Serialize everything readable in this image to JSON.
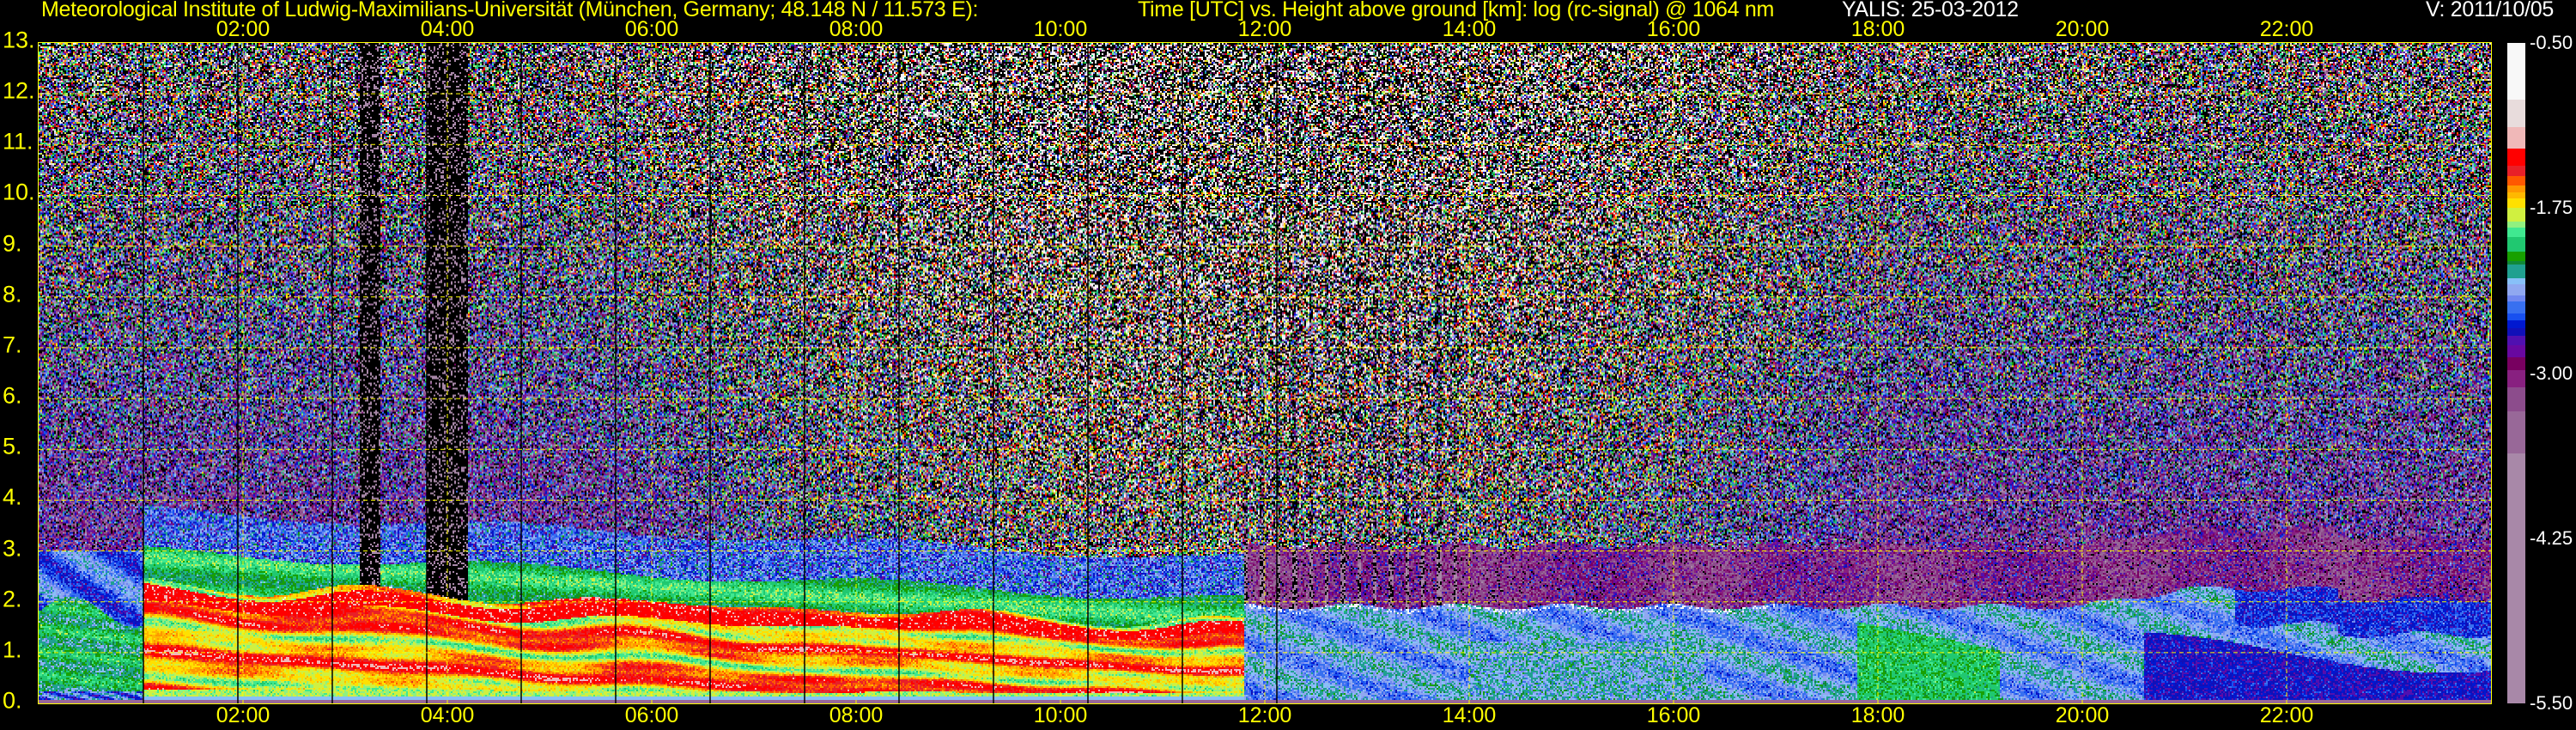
{
  "header": {
    "institute": "Meteorological Institute of Ludwig-Maximilians-Universität (München, Germany; 48.148 N / 11.573 E):",
    "plot_description": "Time [UTC] vs. Height above ground [km]: log (rc-signal) @ 1064 nm",
    "instrument_date": "YALIS: 25-03-2012",
    "version": "V: 2011/10/05"
  },
  "chart_data": {
    "type": "heatmap",
    "title": "Time [UTC] vs. Height above ground [km]: log (rc-signal) @ 1064 nm",
    "xlabel": "Time [UTC]",
    "ylabel": "Height above ground [km]",
    "xlim_hours": [
      0,
      24
    ],
    "ylim_km": [
      0,
      13
    ],
    "x_ticks": [
      "02:00",
      "04:00",
      "06:00",
      "08:00",
      "10:00",
      "12:00",
      "14:00",
      "16:00",
      "18:00",
      "20:00",
      "22:00"
    ],
    "x_tick_hours": [
      2,
      4,
      6,
      8,
      10,
      12,
      14,
      16,
      18,
      20,
      22
    ],
    "y_ticks": [
      "0.",
      "1.",
      "2.",
      "3.",
      "4.",
      "5.",
      "6.",
      "7.",
      "8.",
      "9.",
      "10.",
      "11.",
      "12.",
      "13."
    ],
    "y_tick_km": [
      0,
      1,
      2,
      3,
      4,
      5,
      6,
      7,
      8,
      9,
      10,
      11,
      12,
      13
    ],
    "grid": true,
    "colorbar": {
      "range": [
        -5.5,
        -0.5
      ],
      "tick_labels": [
        "-0.50",
        "-1.75",
        "-3.00",
        "-4.25",
        "-5.50"
      ],
      "tick_values": [
        -0.5,
        -1.75,
        -3.0,
        -4.25,
        -5.5
      ],
      "segments": [
        {
          "top": -0.5,
          "color": "#f8f8f8"
        },
        {
          "top": -0.93,
          "color": "#e8dcdc"
        },
        {
          "top": -1.14,
          "color": "#f0b8b8"
        },
        {
          "top": -1.3,
          "color": "#ff0000"
        },
        {
          "top": -1.43,
          "color": "#e82028"
        },
        {
          "top": -1.51,
          "color": "#ff5800"
        },
        {
          "top": -1.58,
          "color": "#ff9800"
        },
        {
          "top": -1.63,
          "color": "#ffb800"
        },
        {
          "top": -1.68,
          "color": "#ffe000"
        },
        {
          "top": -1.75,
          "color": "#d0f040"
        },
        {
          "top": -1.85,
          "color": "#90f080"
        },
        {
          "top": -1.9,
          "color": "#40e890"
        },
        {
          "top": -1.97,
          "color": "#20c870"
        },
        {
          "top": -2.08,
          "color": "#18a000"
        },
        {
          "top": -2.15,
          "color": "#108838"
        },
        {
          "top": -2.18,
          "color": "#20a090"
        },
        {
          "top": -2.28,
          "color": "#88c0f8"
        },
        {
          "top": -2.33,
          "color": "#90a8f0"
        },
        {
          "top": -2.41,
          "color": "#7088f0"
        },
        {
          "top": -2.46,
          "color": "#3870f0"
        },
        {
          "top": -2.55,
          "color": "#1850f0"
        },
        {
          "top": -2.6,
          "color": "#0018d0"
        },
        {
          "top": -2.66,
          "color": "#1010b8"
        },
        {
          "top": -2.72,
          "color": "#5010b0"
        },
        {
          "top": -2.79,
          "color": "#6808a0"
        },
        {
          "top": -2.88,
          "color": "#780060"
        },
        {
          "top": -2.98,
          "color": "#882080"
        },
        {
          "top": -3.11,
          "color": "#8c4c8c"
        },
        {
          "top": -3.29,
          "color": "#986898"
        },
        {
          "top": -3.61,
          "color": "#a888a8"
        }
      ]
    },
    "features": {
      "boundary_layer_top_km": {
        "01:00": 2.3,
        "11:45": 1.5
      },
      "afternoon_layer_top_km": 1.9,
      "profile_gap_interval_minutes": 55
    }
  }
}
